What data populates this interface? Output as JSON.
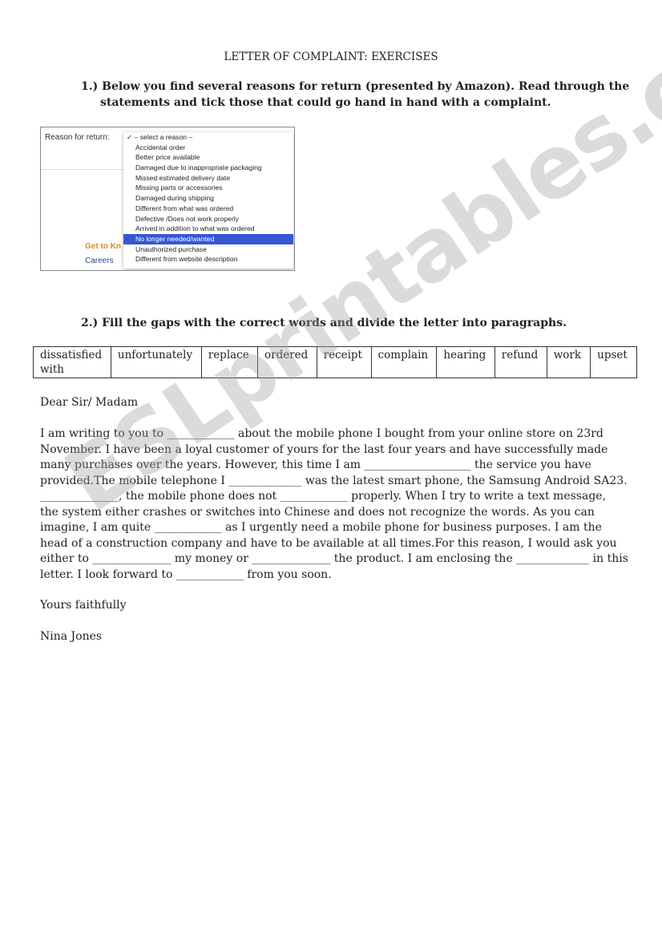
{
  "title": "LETTER OF COMPLAINT: EXERCISES",
  "q1": {
    "line1": "1.) Below you find several reasons for return (presented by Amazon). Read through the",
    "line2": "statements and tick those that could go hand in hand with a complaint."
  },
  "screenshot": {
    "label": "Reason for return:",
    "check": "✓",
    "placeholder": "– select a reason –",
    "options": [
      "Accidental order",
      "Better price available",
      "Damaged due to inappropriate packaging",
      "Missed estimated delivery date",
      "Missing parts or accessories",
      "Damaged during shipping",
      "Different from what was ordered",
      "Defective /Does not work properly",
      "Arrived in addition to what was ordered",
      "No longer needed/wanted",
      "Unauthorized purchase",
      "Different from website description"
    ],
    "selected": "No longer needed/wanted",
    "highlight_color": "#3457d4",
    "footer_link1": "Get to Kn",
    "footer_link2": "Careers"
  },
  "q2": "2.) Fill the gaps with the correct words and divide the letter into paragraphs.",
  "word_bank": [
    [
      "dissatisfied",
      "with"
    ],
    [
      "unfortunately"
    ],
    [
      "replace"
    ],
    [
      "ordered"
    ],
    [
      "receipt"
    ],
    [
      "complain"
    ],
    [
      "hearing"
    ],
    [
      "refund"
    ],
    [
      "work"
    ],
    [
      "upset"
    ]
  ],
  "letter": {
    "greeting": "Dear Sir/ Madam",
    "lines": [
      "I am writing to you to ____________ about the mobile phone I bought from your online store on 23rd",
      "November. I have been a loyal customer of yours for the last four years and have successfully made",
      "many purchases over the years. However, this time I am ___________________ the service you have",
      "provided.The mobile telephone I _____________ was the latest smart phone, the Samsung Android SA23.",
      "______________, the mobile phone does not ____________ properly. When I try to write a text message,",
      "the system either crashes or switches into Chinese and does not recognize the words. As you can",
      "imagine, I am quite ____________ as I urgently need a mobile phone for business purposes. I am the",
      "head of a construction company and have to be available at all times.For this reason, I would ask you",
      "either to ______________ my money or ______________ the product. I am enclosing the _____________ in this",
      "letter. I look forward to ____________ from you soon."
    ],
    "closing": "Yours faithfully",
    "signature": "Nina Jones"
  },
  "watermark": "ESLprintables.com"
}
